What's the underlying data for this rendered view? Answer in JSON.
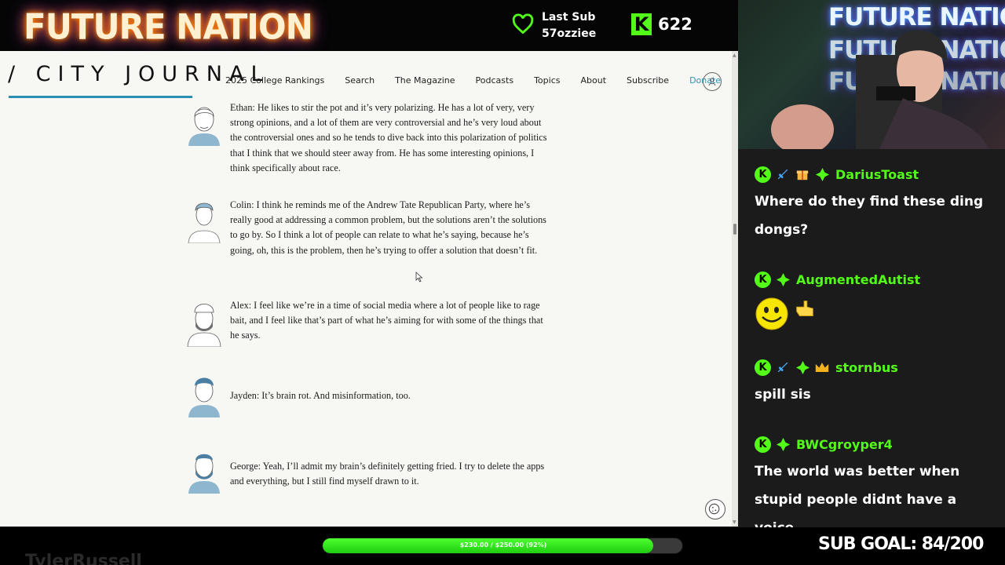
{
  "stream": {
    "brand": "FUTURE NATION",
    "last_sub_label": "Last Sub",
    "last_sub_user": "57ozziee",
    "kick_count": "622",
    "streamer": "TylerRussell",
    "goal_text": "$230.00 / $250.00 (92%)",
    "goal_fraction": 0.92,
    "sub_goal": "SUB GOAL: 84/200",
    "accent": "#53fc18"
  },
  "site": {
    "logo": "/ CITY JOURNAL",
    "nav": [
      "2025 College Rankings",
      "Search",
      "The Magazine",
      "Podcasts",
      "Topics",
      "About",
      "Subscribe"
    ],
    "donate": "Donate",
    "accent": "#2a93b8"
  },
  "quotes": [
    {
      "text": "Ethan: He likes to stir the pot and it’s very polarizing. He has a lot of very, very strong opinions, and a lot of them are very controversial and he’s very loud about the controversial ones and so he tends to dive back into this polarization of politics that I think that we should steer away from. He has some interesting opinions, I think specifically about race."
    },
    {
      "text": "Colin: I think he reminds me of the Andrew Tate Republican Party, where he’s really good at addressing a common problem, but the solutions aren’t the solutions to go by. So I think a lot of people can relate to what he’s saying, because he’s going, oh, this is the problem, then he’s trying to offer a solution that doesn’t fit."
    },
    {
      "text": "Alex: I feel like we’re in a time of social media where a lot of people like to rage bait, and I feel like that’s part of what he’s aiming for with some of the things that he says."
    },
    {
      "text": "Jayden: It’s brain rot. And misinformation, too."
    },
    {
      "text": "George: Yeah, I’ll admit my brain’s definitely getting fried. I try to delete the apps and everything, but I still find myself drawn to it."
    }
  ],
  "chat": [
    {
      "user": "DariusToast",
      "badges": [
        "kick-badge",
        "sword-badge",
        "gift-badge",
        "sub-badge"
      ],
      "message": "Where do they find these ding dongs?"
    },
    {
      "user": "AugmentedAutist",
      "badges": [
        "kick-badge",
        "sub-badge"
      ],
      "message": "",
      "emotes": [
        "smiley-emote",
        "pointing-hand-emote"
      ]
    },
    {
      "user": "stornbus",
      "badges": [
        "kick-badge",
        "sword-badge",
        "sub-badge",
        "crown-badge"
      ],
      "message": "spill sis"
    },
    {
      "user": "BWCgroyper4",
      "badges": [
        "kick-badge",
        "sub-badge"
      ],
      "message": "The world was better when stupid people didnt have a voice"
    }
  ]
}
